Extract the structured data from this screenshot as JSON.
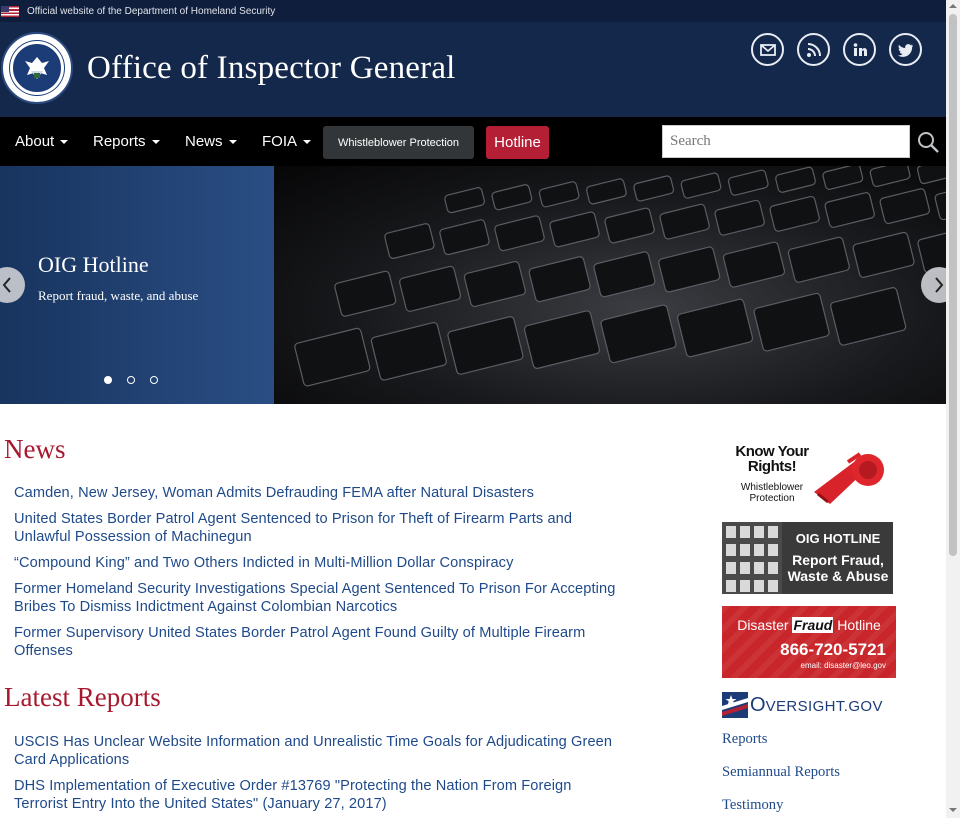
{
  "official_banner": {
    "text": "Official website of the Department of Homeland Security"
  },
  "header": {
    "seal_text": "U.S. DEPARTMENT OF HOMELAND SECURITY",
    "title": "Office of Inspector General",
    "social": [
      "email-icon",
      "rss-icon",
      "linkedin-icon",
      "twitter-icon"
    ]
  },
  "nav": {
    "items": [
      "About",
      "Reports",
      "News",
      "FOIA"
    ],
    "whistleblower": "Whistleblower Protection",
    "hotline": "Hotline",
    "search_placeholder": "Search"
  },
  "carousel": {
    "title": "OIG Hotline",
    "subtitle": "Report fraud, waste, and abuse",
    "slide_count": 3,
    "active_slide": 1
  },
  "news": {
    "heading": "News",
    "items": [
      "Camden, New Jersey, Woman Admits Defrauding FEMA after Natural Disasters",
      "United States Border Patrol Agent Sentenced to Prison for Theft of Firearm Parts and Unlawful Possession of Machinegun",
      "“Compound King” and Two Others Indicted in Multi-Million Dollar Conspiracy",
      "Former Homeland Security Investigations Special Agent Sentenced To Prison For Accepting Bribes To Dismiss Indictment Against Colombian Narcotics",
      "Former Supervisory United States Border Patrol Agent Found Guilty of Multiple Firearm Offenses"
    ]
  },
  "reports": {
    "heading": "Latest Reports",
    "items": [
      "USCIS Has Unclear Website Information and Unrealistic Time Goals for Adjudicating Green Card Applications",
      "DHS Implementation of Executive Order #13769 \"Protecting the Nation From Foreign Terrorist Entry Into the United States\" (January 27, 2017)"
    ]
  },
  "sidebar": {
    "know_rights": {
      "line1": "Know Your",
      "line2": "Rights!",
      "line3": "Whistleblower",
      "line4": "Protection"
    },
    "hotline_banner": {
      "line1": "OIG HOTLINE",
      "line2": "Report Fraud,",
      "line3": "Waste & Abuse"
    },
    "disaster_banner": {
      "prefix": "Disaster ",
      "emphasis": "Fraud",
      "suffix": " Hotline",
      "phone": "866-720-5721",
      "email": "email: disaster@leo.gov"
    },
    "oversight": {
      "initial": "O",
      "rest": "VERSIGHT.GOV"
    },
    "links": [
      "Reports",
      "Semiannual Reports",
      "Testimony"
    ]
  },
  "colors": {
    "header_bg": "#14284b",
    "accent_red": "#a71930",
    "link_blue": "#1f4a8a",
    "hotline_red": "#b51f36"
  }
}
